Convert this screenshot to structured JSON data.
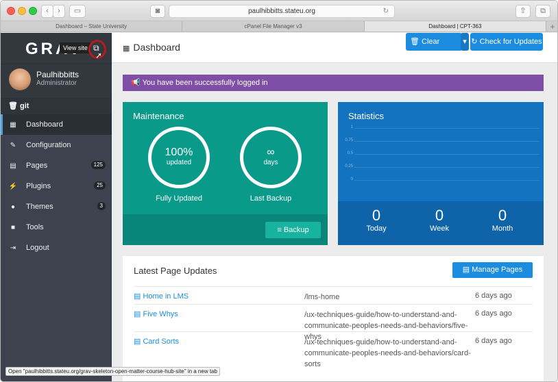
{
  "browser": {
    "url": "paulhibbitts.stateu.org",
    "tabs": [
      "Dashboard – State University",
      "cPanel File Manager v3",
      "Dashboard | CPT-363"
    ],
    "tab_plus": "+"
  },
  "sidebar": {
    "logo": "GRAV",
    "view_site_tooltip": "View site",
    "user_name": "Paulhibbitts",
    "user_role": "Administrator",
    "git_label": "git",
    "items": [
      {
        "label": "Dashboard",
        "icon": "grid-icon",
        "badge": ""
      },
      {
        "label": "Configuration",
        "icon": "wrench-icon",
        "badge": ""
      },
      {
        "label": "Pages",
        "icon": "file-icon",
        "badge": "125"
      },
      {
        "label": "Plugins",
        "icon": "plug-icon",
        "badge": "25"
      },
      {
        "label": "Themes",
        "icon": "tint-icon",
        "badge": "3"
      },
      {
        "label": "Tools",
        "icon": "briefcase-icon",
        "badge": ""
      },
      {
        "label": "Logout",
        "icon": "sign-out-icon",
        "badge": ""
      }
    ]
  },
  "header": {
    "title": "Dashboard",
    "clear_cache": "Clear Cache",
    "check_updates": "Check for Updates"
  },
  "alert": "You have been successfully logged in",
  "maintenance": {
    "title": "Maintenance",
    "updated_value": "100%",
    "updated_sub": "updated",
    "updated_label": "Fully Updated",
    "backup_value": "∞",
    "backup_sub": "days",
    "backup_label": "Last Backup",
    "backup_button": "Backup"
  },
  "statistics": {
    "title": "Statistics",
    "ticks": [
      "1",
      "0.75",
      "0.5",
      "0.25",
      "0"
    ],
    "today_value": "0",
    "today_label": "Today",
    "week_value": "0",
    "week_label": "Week",
    "month_value": "0",
    "month_label": "Month"
  },
  "latest": {
    "title": "Latest Page Updates",
    "manage_button": "Manage Pages",
    "rows": [
      {
        "title": "Home in LMS",
        "route": "/lms-home",
        "age": "6 days ago"
      },
      {
        "title": "Five Whys",
        "route": "/ux-techniques-guide/how-to-understand-and-communicate-peoples-needs-and-behaviors/five-whys",
        "age": "6 days ago"
      },
      {
        "title": "Card Sorts",
        "route": "/ux-techniques-guide/how-to-understand-and-communicate-peoples-needs-and-behaviors/card-sorts",
        "age": "6 days ago"
      }
    ]
  },
  "status_text": "Open \"paulhibbitts.stateu.org/grav-skeleton-open-matter-course-hub-site\" in a new tab"
}
